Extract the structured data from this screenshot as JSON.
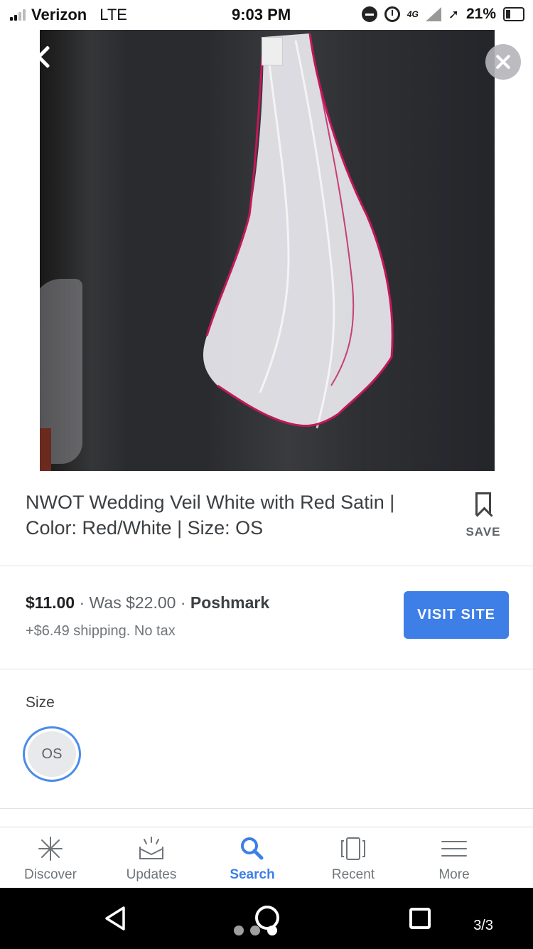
{
  "status_bar": {
    "carrier": "Verizon",
    "network": "LTE",
    "time": "9:03 PM",
    "network_gen": "4G",
    "battery": "21%"
  },
  "product": {
    "title": "NWOT Wedding Veil White with Red Satin | Color: Red/White | Size: OS",
    "save_label": "SAVE"
  },
  "offer": {
    "price": "$11.00",
    "was_price": "Was $22.00",
    "merchant": "Poshmark",
    "shipping": "+$6.49 shipping. No tax",
    "visit_label": "VISIT SITE"
  },
  "size": {
    "label": "Size",
    "options": [
      "OS"
    ],
    "selected": "OS"
  },
  "bottom_nav": {
    "items": [
      {
        "label": "Discover",
        "icon": "asterisk-icon"
      },
      {
        "label": "Updates",
        "icon": "updates-inbox-icon"
      },
      {
        "label": "Search",
        "icon": "search-icon"
      },
      {
        "label": "Recent",
        "icon": "recent-cards-icon"
      },
      {
        "label": "More",
        "icon": "menu-icon"
      }
    ],
    "active": "Search"
  },
  "system_nav": {
    "page_indicator": "3/3"
  },
  "colors": {
    "accent": "#3d7ee7",
    "text": "#3c4043"
  }
}
